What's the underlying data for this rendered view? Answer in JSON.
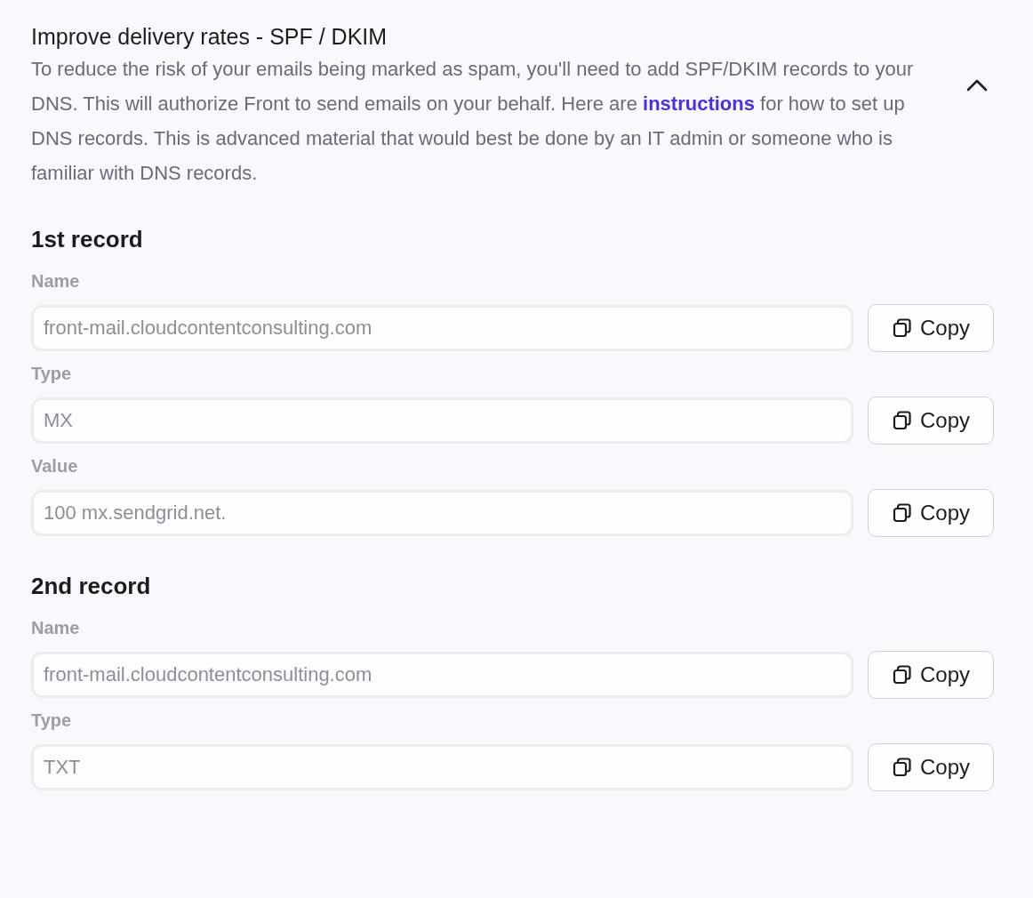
{
  "section": {
    "title": "Improve delivery rates - SPF / DKIM",
    "description_before": "To reduce the risk of your emails being marked as spam, you'll need to add SPF/DKIM records to your DNS. This will authorize Front to send emails on your behalf. Here are",
    "link": "instructions",
    "description_after": "for how to set up DNS records. This is advanced material that would best be done by an IT admin or someone who is familiar with DNS records.",
    "expanded": true
  },
  "records": [
    {
      "heading": "1st record",
      "fields": [
        {
          "label": "Name",
          "value": "front-mail.cloudcontentconsulting.com",
          "button": "Copy"
        },
        {
          "label": "Type",
          "value": "MX",
          "button": "Copy"
        },
        {
          "label": "Value",
          "value": "100 mx.sendgrid.net.",
          "button": "Copy"
        }
      ]
    },
    {
      "heading": "2nd record",
      "fields": [
        {
          "label": "Name",
          "value": "front-mail.cloudcontentconsulting.com",
          "button": "Copy"
        },
        {
          "label": "Type",
          "value": "TXT",
          "button": "Copy"
        }
      ]
    }
  ]
}
